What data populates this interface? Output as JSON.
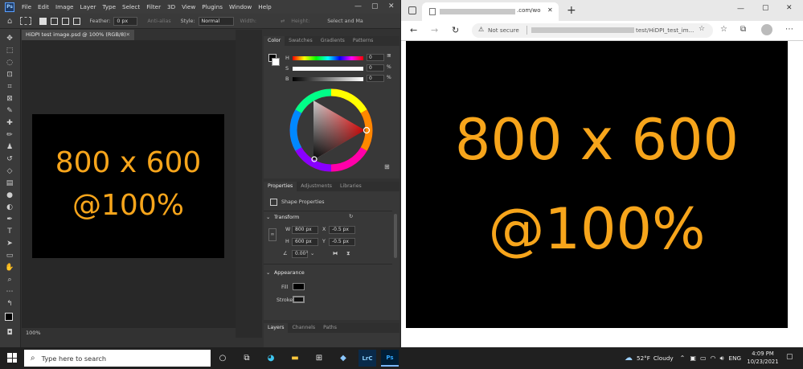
{
  "photoshop": {
    "logo": "Ps",
    "menu": [
      "File",
      "Edit",
      "Image",
      "Layer",
      "Type",
      "Select",
      "Filter",
      "3D",
      "View",
      "Plugins",
      "Window",
      "Help"
    ],
    "options": {
      "feather_label": "Feather:",
      "feather_value": "0 px",
      "antialias_label": "Anti-alias",
      "style_label": "Style:",
      "style_value": "Normal",
      "width_label": "Width:",
      "height_label": "Height:",
      "select_mask_label": "Select and Ma"
    },
    "document_tab": "HiDPI test image.psd @ 100% (RGB/8)",
    "zoom_level": "100%",
    "canvas_text_line1": "800 x 600",
    "canvas_text_line2": "@100%",
    "color_panel": {
      "tabs": [
        "Color",
        "Swatches",
        "Gradients",
        "Patterns"
      ],
      "h_label": "H",
      "s_label": "S",
      "b_label": "B",
      "h_value": "0",
      "s_value": "0",
      "b_value": "0",
      "h_unit": "°",
      "s_unit": "%",
      "b_unit": "%"
    },
    "properties_panel": {
      "tabs": [
        "Properties",
        "Adjustments",
        "Libraries"
      ],
      "shape_properties": "Shape Properties",
      "transform_label": "Transform",
      "w_label": "W",
      "w_value": "800 px",
      "h_label": "H",
      "h_value": "600 px",
      "x_label": "X",
      "x_value": "-0.5 px",
      "y_label": "Y",
      "y_value": "-0.5 px",
      "angle_value": "0.00°",
      "appearance_label": "Appearance",
      "fill_label": "Fill",
      "stroke_label": "Stroke"
    },
    "layers_panel": {
      "tabs": [
        "Layers",
        "Channels",
        "Paths"
      ]
    }
  },
  "browser": {
    "url_suffix": ".com/wo",
    "not_secure": "Not secure",
    "address_path": "test/HiDPI_test_im...",
    "content_line1": "800 x 600",
    "content_line2": "@100%"
  },
  "taskbar": {
    "search_placeholder": "Type here to search",
    "weather_temp": "52°F",
    "weather_desc": "Cloudy",
    "language": "ENG",
    "time": "4:09 PM",
    "date": "10/23/2021",
    "lrc_label": "LrC",
    "ps_label": "Ps"
  },
  "colors": {
    "orange": "#f7a51b",
    "ps_bg": "#323232",
    "canvas_bg": "#000000"
  }
}
